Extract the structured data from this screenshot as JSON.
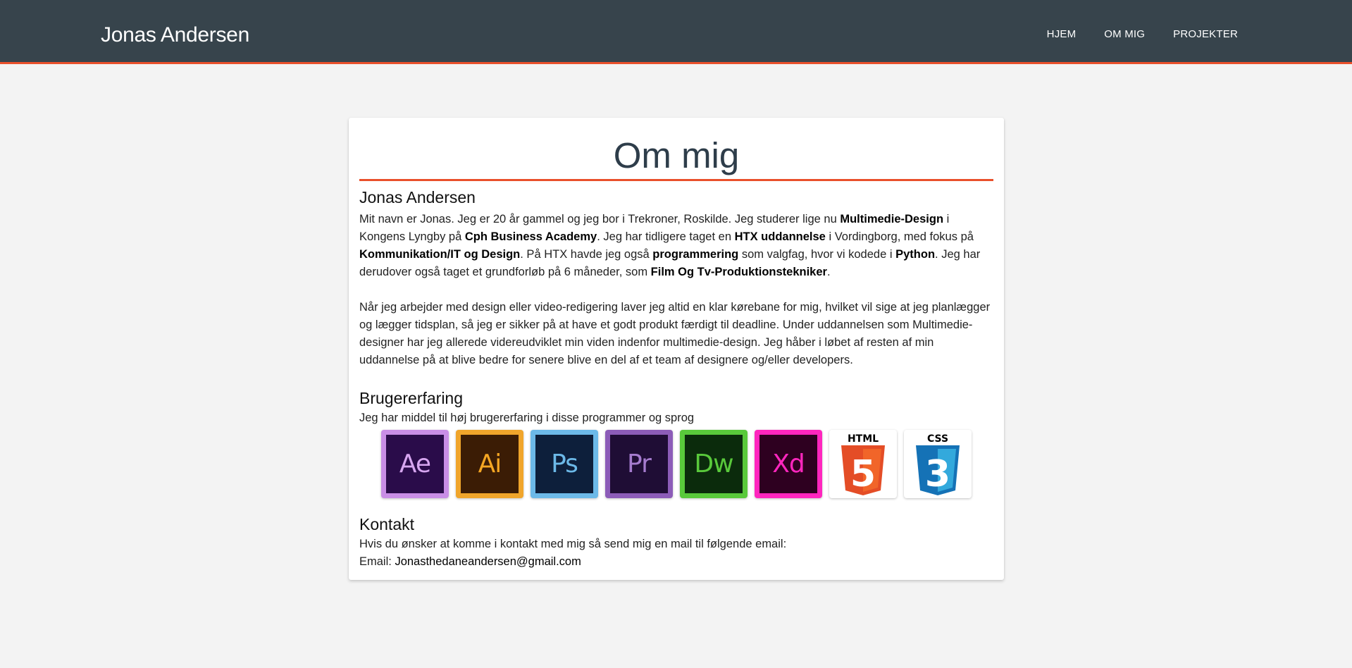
{
  "header": {
    "brand": "Jonas Andersen",
    "nav": [
      "HJEM",
      "OM MIG",
      "PROJEKTER"
    ]
  },
  "card": {
    "title": "Om mig",
    "intro_heading": "Jonas Andersen",
    "p1": [
      {
        "t": "Mit navn er Jonas. Jeg er 20 år gammel og jeg bor i Trekroner, Roskilde. Jeg studerer lige nu "
      },
      {
        "t": "Multimedie-Design",
        "b": true
      },
      {
        "t": " i Kongens Lyngby på "
      },
      {
        "t": "Cph Business Academy",
        "b": true
      },
      {
        "t": ". Jeg har tidligere taget en "
      },
      {
        "t": "HTX uddannelse",
        "b": true
      },
      {
        "t": " i Vordingborg, med fokus på "
      },
      {
        "t": "Kommunikation/IT og Design",
        "b": true
      },
      {
        "t": ". På HTX havde jeg også "
      },
      {
        "t": "programmering",
        "b": true
      },
      {
        "t": " som valgfag, hvor vi kodede i "
      },
      {
        "t": "Python",
        "b": true
      },
      {
        "t": ". Jeg har derudover også taget et grundforløb på 6 måneder, som "
      },
      {
        "t": "Film Og Tv-Produktionstekniker",
        "b": true
      },
      {
        "t": "."
      }
    ],
    "p2": "Når jeg arbejder med design eller video-redigering laver jeg altid en klar kørebane for mig, hvilket vil sige at jeg planlægger og lægger tidsplan, så jeg er sikker på at have et godt produkt færdigt til deadline. Under uddannelsen som Multimedie-designer har jeg allerede videreudviklet min viden indenfor multimedie-design. Jeg håber i løbet af resten af min uddannelse på at blive bedre for senere blive en del af et team af designere og/eller developers.",
    "experience": {
      "heading": "Brugererfaring",
      "subtitle": "Jeg har middel til høj brugererfaring i disse programmer og sprog",
      "icons": [
        {
          "name": "after-effects-icon",
          "label": "Ae",
          "border": "#c98ee6",
          "bg": "#2a0c4a",
          "fg": "#d7a6f0"
        },
        {
          "name": "illustrator-icon",
          "label": "Ai",
          "border": "#f0a52b",
          "bg": "#3b1c05",
          "fg": "#f5a623"
        },
        {
          "name": "photoshop-icon",
          "label": "Ps",
          "border": "#6cb9e8",
          "bg": "#0d1f3b",
          "fg": "#6cb9e8"
        },
        {
          "name": "premiere-icon",
          "label": "Pr",
          "border": "#8c5cb8",
          "bg": "#1f0d35",
          "fg": "#a67ccf"
        },
        {
          "name": "dreamweaver-icon",
          "label": "Dw",
          "border": "#59c93b",
          "bg": "#0b2b0c",
          "fg": "#59c93b"
        },
        {
          "name": "xd-icon",
          "label": "Xd",
          "border": "#ff26be",
          "bg": "#2e0020",
          "fg": "#ff26be"
        },
        {
          "name": "html5-icon",
          "label": "HTML",
          "glyph": "5",
          "fg": "#e44d26",
          "shade": "#f16529"
        },
        {
          "name": "css3-icon",
          "label": "CSS",
          "glyph": "3",
          "fg": "#1572b6",
          "shade": "#33a9dc"
        }
      ]
    },
    "contact": {
      "heading": "Kontakt",
      "text": "Hvis du ønsker at komme i kontakt med mig så send mig en mail til følgende email:",
      "email_label": "Email: ",
      "email": "Jonasthedaneandersen@gmail.com"
    }
  }
}
